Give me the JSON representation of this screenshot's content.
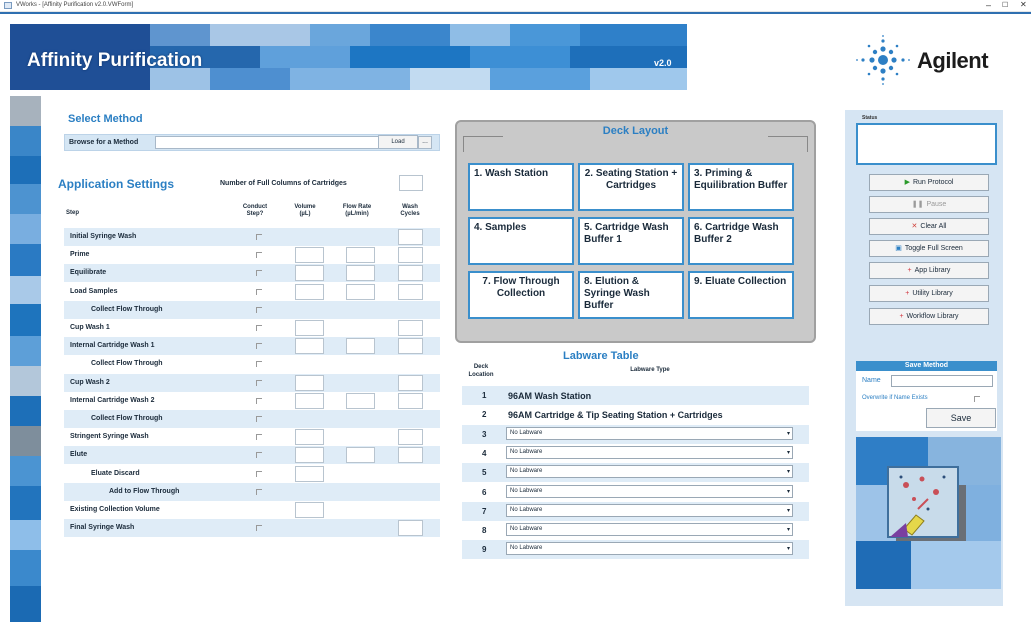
{
  "window": {
    "title": "VWorks - [Affinity Purification v2.0.VWForm]",
    "minimize": "–",
    "maximize": "☐",
    "close": "✕"
  },
  "banner": {
    "app_name": "Affinity Purification",
    "version": "v2.0",
    "brand": "Agilent"
  },
  "select_method": {
    "title": "Select Method",
    "browse_label": "Browse for a Method",
    "browse_value": "",
    "browse_button": "...",
    "load_button": "Load"
  },
  "app_settings": {
    "title": "Application Settings",
    "num_columns_label": "Number of Full Columns of Cartridges",
    "num_columns_value": "",
    "headers": {
      "step": "Step",
      "conduct": "Conduct Step?",
      "volume": "Volume (µL)",
      "flow": "Flow Rate (µL/min)",
      "wash": "Wash Cycles"
    },
    "rows": [
      {
        "name": "Initial Syringe Wash",
        "indent": 0,
        "shade": true,
        "chk": true,
        "vol": false,
        "flow": false,
        "wash": true
      },
      {
        "name": "Prime",
        "indent": 0,
        "shade": false,
        "chk": true,
        "vol": true,
        "flow": true,
        "wash": true
      },
      {
        "name": "Equilibrate",
        "indent": 0,
        "shade": true,
        "chk": true,
        "vol": true,
        "flow": true,
        "wash": true
      },
      {
        "name": "Load Samples",
        "indent": 0,
        "shade": false,
        "chk": true,
        "vol": true,
        "flow": true,
        "wash": true
      },
      {
        "name": "Collect Flow Through",
        "indent": 1,
        "shade": true,
        "chk": true,
        "vol": false,
        "flow": false,
        "wash": false
      },
      {
        "name": "Cup Wash 1",
        "indent": 0,
        "shade": false,
        "chk": true,
        "vol": true,
        "flow": false,
        "wash": true
      },
      {
        "name": "Internal Cartridge Wash 1",
        "indent": 0,
        "shade": true,
        "chk": true,
        "vol": true,
        "flow": true,
        "wash": true
      },
      {
        "name": "Collect Flow Through",
        "indent": 1,
        "shade": false,
        "chk": true,
        "vol": false,
        "flow": false,
        "wash": false
      },
      {
        "name": "Cup Wash 2",
        "indent": 0,
        "shade": true,
        "chk": true,
        "vol": true,
        "flow": false,
        "wash": true
      },
      {
        "name": "Internal Cartridge Wash 2",
        "indent": 0,
        "shade": false,
        "chk": true,
        "vol": true,
        "flow": true,
        "wash": true
      },
      {
        "name": "Collect Flow Through",
        "indent": 1,
        "shade": true,
        "chk": true,
        "vol": false,
        "flow": false,
        "wash": false
      },
      {
        "name": "Stringent Syringe Wash",
        "indent": 0,
        "shade": false,
        "chk": true,
        "vol": true,
        "flow": false,
        "wash": true
      },
      {
        "name": "Elute",
        "indent": 0,
        "shade": true,
        "chk": true,
        "vol": true,
        "flow": true,
        "wash": true
      },
      {
        "name": "Eluate Discard",
        "indent": 1,
        "shade": false,
        "chk": true,
        "vol": true,
        "flow": false,
        "wash": false
      },
      {
        "name": "Add to Flow Through",
        "indent": 2,
        "shade": true,
        "chk": true,
        "vol": false,
        "flow": false,
        "wash": false
      },
      {
        "name": "Existing Collection Volume",
        "indent": 0,
        "shade": false,
        "chk": false,
        "vol": true,
        "flow": false,
        "wash": false
      },
      {
        "name": "Final Syringe Wash",
        "indent": 0,
        "shade": true,
        "chk": true,
        "vol": false,
        "flow": false,
        "wash": true
      }
    ]
  },
  "deck": {
    "title": "Deck Layout",
    "cells": [
      "1. Wash Station",
      "2. Seating Station + Cartridges",
      "3. Priming & Equilibration Buffer",
      "4. Samples",
      "5. Cartridge Wash Buffer 1",
      "6. Cartridge Wash Buffer 2",
      "7. Flow Through Collection",
      "8. Elution & Syringe Wash Buffer",
      "9. Eluate Collection"
    ]
  },
  "labware": {
    "title": "Labware Table",
    "col_deck": "Deck Location",
    "col_type": "Labware Type",
    "rows": [
      {
        "loc": "1",
        "type": "96AM Wash Station",
        "fixed": true
      },
      {
        "loc": "2",
        "type": "96AM Cartridge & Tip Seating Station + Cartridges",
        "fixed": true
      },
      {
        "loc": "3",
        "type": "No Labware",
        "fixed": false
      },
      {
        "loc": "4",
        "type": "No Labware",
        "fixed": false
      },
      {
        "loc": "5",
        "type": "No Labware",
        "fixed": false
      },
      {
        "loc": "6",
        "type": "No Labware",
        "fixed": false
      },
      {
        "loc": "7",
        "type": "No Labware",
        "fixed": false
      },
      {
        "loc": "8",
        "type": "No Labware",
        "fixed": false
      },
      {
        "loc": "9",
        "type": "No Labware",
        "fixed": false
      }
    ]
  },
  "control": {
    "status_label": "Status",
    "status_value": "",
    "buttons": [
      {
        "label": "Run Protocol",
        "icon": "play-icon",
        "disabled": false
      },
      {
        "label": "Pause",
        "icon": "pause-icon",
        "disabled": true
      },
      {
        "label": "Clear All",
        "icon": "clear-icon",
        "disabled": false
      },
      {
        "label": "Toggle Full Screen",
        "icon": "fullscreen-icon",
        "disabled": false
      },
      {
        "label": "App Library",
        "icon": "plus-icon",
        "disabled": false
      },
      {
        "label": "Utility Library",
        "icon": "plus-icon",
        "disabled": false
      },
      {
        "label": "Workflow Library",
        "icon": "plus-icon",
        "disabled": false
      }
    ],
    "save": {
      "title": "Save Method",
      "name_label": "Name",
      "name_value": "",
      "overwrite_label": "Overwrite if Name Exists",
      "save_button": "Save"
    }
  },
  "colors": {
    "accent": "#2b7fc3",
    "row_shade": "#dfecf7",
    "panel": "#d6e5f3"
  }
}
